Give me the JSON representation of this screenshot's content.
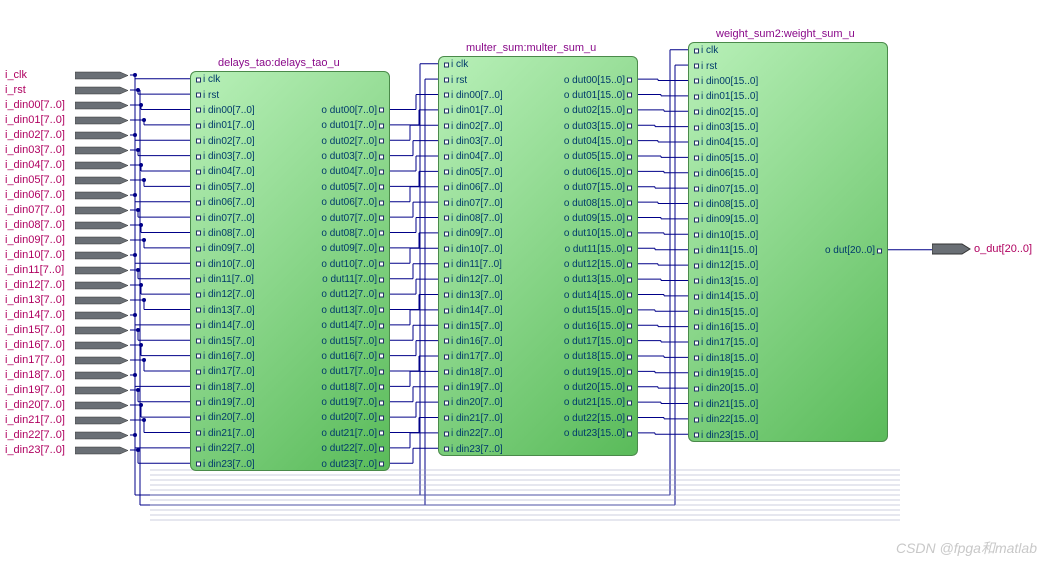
{
  "inputs": {
    "signals": [
      "i_clk",
      "i_rst",
      "i_din00[7..0]",
      "i_din01[7..0]",
      "i_din02[7..0]",
      "i_din03[7..0]",
      "i_din04[7..0]",
      "i_din05[7..0]",
      "i_din06[7..0]",
      "i_din07[7..0]",
      "i_din08[7..0]",
      "i_din09[7..0]",
      "i_din10[7..0]",
      "i_din11[7..0]",
      "i_din12[7..0]",
      "i_din13[7..0]",
      "i_din14[7..0]",
      "i_din15[7..0]",
      "i_din16[7..0]",
      "i_din17[7..0]",
      "i_din18[7..0]",
      "i_din19[7..0]",
      "i_din20[7..0]",
      "i_din21[7..0]",
      "i_din22[7..0]",
      "i_din23[7..0]"
    ]
  },
  "blocks": {
    "b1": {
      "title": "delays_tao:delays_tao_u",
      "in_pins": [
        "i clk",
        "i rst",
        "i din00[7..0]",
        "i din01[7..0]",
        "i din02[7..0]",
        "i din03[7..0]",
        "i din04[7..0]",
        "i din05[7..0]",
        "i din06[7..0]",
        "i din07[7..0]",
        "i din08[7..0]",
        "i din09[7..0]",
        "i din10[7..0]",
        "i din11[7..0]",
        "i din12[7..0]",
        "i din13[7..0]",
        "i din14[7..0]",
        "i din15[7..0]",
        "i din16[7..0]",
        "i din17[7..0]",
        "i din18[7..0]",
        "i din19[7..0]",
        "i din20[7..0]",
        "i din21[7..0]",
        "i din22[7..0]",
        "i din23[7..0]"
      ],
      "out_pins": [
        "",
        "",
        "o dut00[7..0]",
        "o dut01[7..0]",
        "o dut02[7..0]",
        "o dut03[7..0]",
        "o dut04[7..0]",
        "o dut05[7..0]",
        "o dut06[7..0]",
        "o dut07[7..0]",
        "o dut08[7..0]",
        "o dut09[7..0]",
        "o dut10[7..0]",
        "o dut11[7..0]",
        "o dut12[7..0]",
        "o dut13[7..0]",
        "o dut14[7..0]",
        "o dut15[7..0]",
        "o dut16[7..0]",
        "o dut17[7..0]",
        "o dut18[7..0]",
        "o dut19[7..0]",
        "o dut20[7..0]",
        "o dut21[7..0]",
        "o dut22[7..0]",
        "o dut23[7..0]"
      ]
    },
    "b2": {
      "title": "multer_sum:multer_sum_u",
      "in_pins": [
        "i clk",
        "i rst",
        "i din00[7..0]",
        "i din01[7..0]",
        "i din02[7..0]",
        "i din03[7..0]",
        "i din04[7..0]",
        "i din05[7..0]",
        "i din06[7..0]",
        "i din07[7..0]",
        "i din08[7..0]",
        "i din09[7..0]",
        "i din10[7..0]",
        "i din11[7..0]",
        "i din12[7..0]",
        "i din13[7..0]",
        "i din14[7..0]",
        "i din15[7..0]",
        "i din16[7..0]",
        "i din17[7..0]",
        "i din18[7..0]",
        "i din19[7..0]",
        "i din20[7..0]",
        "i din21[7..0]",
        "i din22[7..0]",
        "i din23[7..0]"
      ],
      "out_pins": [
        "",
        "o dut00[15..0]",
        "o dut01[15..0]",
        "o dut02[15..0]",
        "o dut03[15..0]",
        "o dut04[15..0]",
        "o dut05[15..0]",
        "o dut06[15..0]",
        "o dut07[15..0]",
        "o dut08[15..0]",
        "o dut09[15..0]",
        "o dut10[15..0]",
        "o dut11[15..0]",
        "o dut12[15..0]",
        "o dut13[15..0]",
        "o dut14[15..0]",
        "o dut15[15..0]",
        "o dut16[15..0]",
        "o dut17[15..0]",
        "o dut18[15..0]",
        "o dut19[15..0]",
        "o dut20[15..0]",
        "o dut21[15..0]",
        "o dut22[15..0]",
        "o dut23[15..0]",
        ""
      ]
    },
    "b3": {
      "title": "weight_sum2:weight_sum_u",
      "in_pins": [
        "i clk",
        "i rst",
        "i din00[15..0]",
        "i din01[15..0]",
        "i din02[15..0]",
        "i din03[15..0]",
        "i din04[15..0]",
        "i din05[15..0]",
        "i din06[15..0]",
        "i din07[15..0]",
        "i din08[15..0]",
        "i din09[15..0]",
        "i din10[15..0]",
        "i din11[15..0]",
        "i din12[15..0]",
        "i din13[15..0]",
        "i din14[15..0]",
        "i din15[15..0]",
        "i din16[15..0]",
        "i din17[15..0]",
        "i din18[15..0]",
        "i din19[15..0]",
        "i din20[15..0]",
        "i din21[15..0]",
        "i din22[15..0]",
        "i din23[15..0]"
      ],
      "out_pins": [
        "",
        "",
        "",
        "",
        "",
        "",
        "",
        "",
        "",
        "",
        "",
        "",
        "",
        "o dut[20..0]",
        "",
        "",
        "",
        "",
        "",
        "",
        "",
        "",
        "",
        "",
        "",
        ""
      ]
    }
  },
  "output": {
    "label": "o_dut[20..0]"
  },
  "watermark": "CSDN @fpga和matlab"
}
